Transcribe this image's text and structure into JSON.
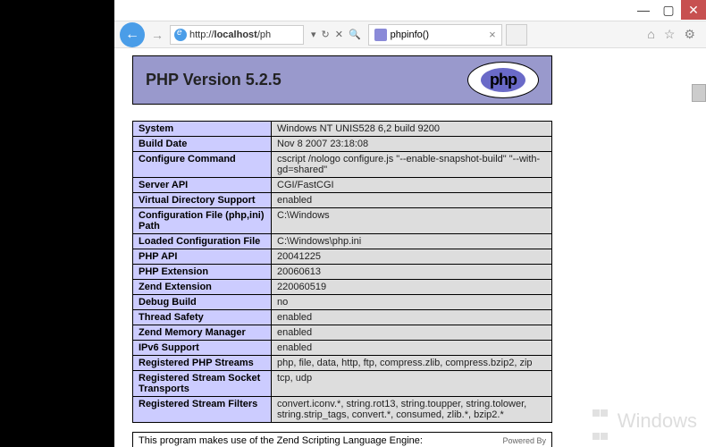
{
  "window": {
    "minimize": "—",
    "maximize": "▢",
    "close": "✕"
  },
  "nav": {
    "back": "←",
    "forward": "→",
    "address_prefix": "http://",
    "address_host": "localhost",
    "address_path": "/ph",
    "refresh": "↻",
    "stop": "✕",
    "search": "🔍"
  },
  "tab": {
    "title": "phpinfo()",
    "close": "×"
  },
  "tools": {
    "home": "⌂",
    "fav": "☆",
    "gear": "⚙"
  },
  "page": {
    "title": "PHP Version 5.2.5",
    "logo": "php"
  },
  "rows": [
    {
      "k": "System",
      "v": "Windows NT UNIS528 6,2 build 9200"
    },
    {
      "k": "Build Date",
      "v": "Nov 8 2007 23:18:08"
    },
    {
      "k": "Configure Command",
      "v": "cscript /nologo configure.js \"--enable-snapshot-build\" \"--with-gd=shared\""
    },
    {
      "k": "Server API",
      "v": "CGI/FastCGI"
    },
    {
      "k": "Virtual Directory Support",
      "v": "enabled"
    },
    {
      "k": "Configuration File (php,ini) Path",
      "v": "C:\\Windows"
    },
    {
      "k": "Loaded Configuration File",
      "v": "C:\\Windows\\php.ini"
    },
    {
      "k": "PHP API",
      "v": "20041225"
    },
    {
      "k": "PHP Extension",
      "v": "20060613"
    },
    {
      "k": "Zend Extension",
      "v": "220060519"
    },
    {
      "k": "Debug Build",
      "v": "no"
    },
    {
      "k": "Thread Safety",
      "v": "enabled"
    },
    {
      "k": "Zend Memory Manager",
      "v": "enabled"
    },
    {
      "k": "IPv6 Support",
      "v": "enabled"
    },
    {
      "k": "Registered PHP Streams",
      "v": "php, file, data, http, ftp, compress.zlib, compress.bzip2, zip"
    },
    {
      "k": "Registered Stream Socket Transports",
      "v": "tcp, udp"
    },
    {
      "k": "Registered Stream Filters",
      "v": "convert.iconv.*, string.rot13, string.toupper, string.tolower, string.strip_tags, convert.*, consumed, zlib.*, bzip2.*"
    }
  ],
  "footer": {
    "text": "This program makes use of the Zend Scripting Language Engine:",
    "powered": "Powered By"
  },
  "watermark": "Windows"
}
